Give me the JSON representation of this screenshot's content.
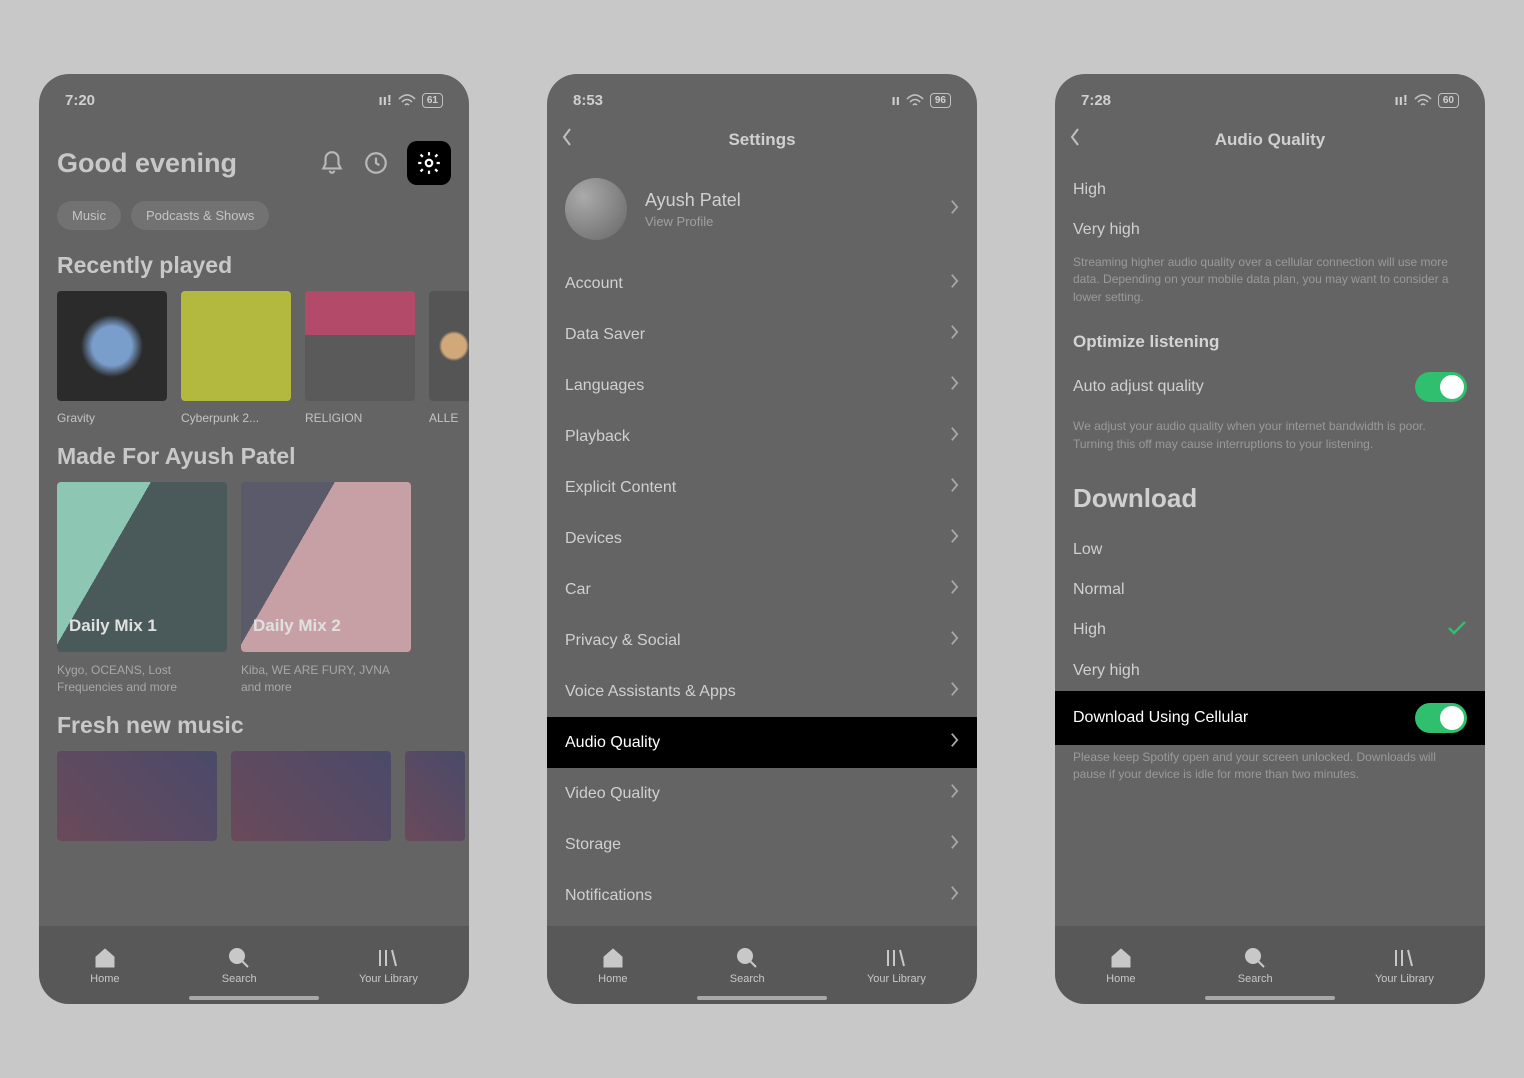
{
  "screen1": {
    "status": {
      "time": "7:20",
      "battery": "61"
    },
    "greeting": "Good evening",
    "chips": [
      "Music",
      "Podcasts & Shows"
    ],
    "sections": {
      "recently": {
        "title": "Recently played",
        "items": [
          {
            "label": "Gravity"
          },
          {
            "label": "Cyberpunk 2..."
          },
          {
            "label": "RELIGION"
          },
          {
            "label": "ALLE"
          }
        ]
      },
      "made_for": {
        "title": "Made For Ayush Patel",
        "items": [
          {
            "badge": "Daily Mix 1",
            "sub": "Kygo, OCEANS, Lost Frequencies and more"
          },
          {
            "badge": "Daily Mix 2",
            "sub": "Kiba, WE ARE FURY, JVNA and more"
          }
        ]
      },
      "fresh": {
        "title": "Fresh new music"
      }
    },
    "nav": {
      "home": "Home",
      "search": "Search",
      "library": "Your Library"
    }
  },
  "screen2": {
    "status": {
      "time": "8:53",
      "battery": "96"
    },
    "title": "Settings",
    "profile": {
      "name": "Ayush Patel",
      "sub": "View Profile"
    },
    "items": [
      "Account",
      "Data Saver",
      "Languages",
      "Playback",
      "Explicit Content",
      "Devices",
      "Car",
      "Privacy & Social",
      "Voice Assistants & Apps",
      "Audio Quality",
      "Video Quality",
      "Storage",
      "Notifications"
    ],
    "highlight_index": 9,
    "nav": {
      "home": "Home",
      "search": "Search",
      "library": "Your Library"
    }
  },
  "screen3": {
    "status": {
      "time": "7:28",
      "battery": "60"
    },
    "title": "Audio Quality",
    "stream_opts": [
      "High",
      "Very high"
    ],
    "stream_help": "Streaming higher audio quality over a cellular connection will use more data. Depending on your mobile data plan, you may want to consider a lower setting.",
    "optimize": {
      "head": "Optimize listening",
      "label": "Auto adjust quality",
      "help": "We adjust your audio quality when your internet bandwidth is poor. Turning this off may cause interruptions to your listening."
    },
    "download": {
      "head": "Download",
      "opts": [
        "Low",
        "Normal",
        "High",
        "Very high"
      ],
      "selected_index": 2,
      "cellular": {
        "label": "Download Using Cellular",
        "help": "Please keep Spotify open and your screen unlocked. Downloads will pause if your device is idle for more than two minutes."
      }
    },
    "nav": {
      "home": "Home",
      "search": "Search",
      "library": "Your Library"
    }
  }
}
